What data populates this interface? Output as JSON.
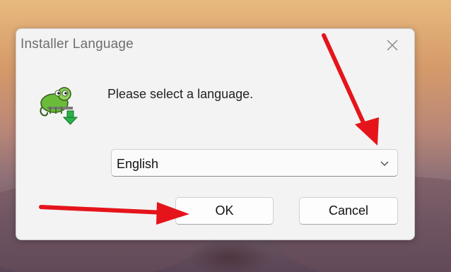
{
  "dialog": {
    "title": "Installer Language",
    "prompt": "Please select a language.",
    "language_select": {
      "selected": "English"
    },
    "buttons": {
      "ok": "OK",
      "cancel": "Cancel"
    }
  },
  "icons": {
    "close": "close-icon",
    "app": "chameleon-installer-icon",
    "chevron": "chevron-down-icon"
  },
  "colors": {
    "annotation_arrow": "#e5141b",
    "dialog_background": "#f3f3f3",
    "title_text": "#6d6d6d"
  }
}
